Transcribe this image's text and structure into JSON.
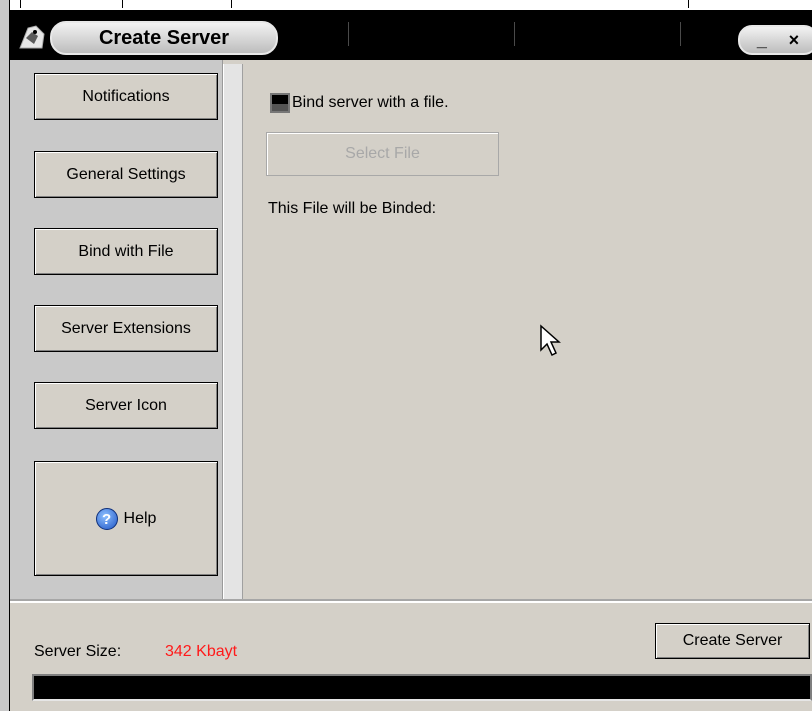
{
  "window": {
    "title": "Create Server",
    "controls": {
      "minimize": "_",
      "close": "×"
    }
  },
  "sidebar": {
    "items": [
      {
        "label": "Notifications"
      },
      {
        "label": "General Settings"
      },
      {
        "label": "Bind with File"
      },
      {
        "label": "Server Extensions"
      },
      {
        "label": "Server Icon"
      },
      {
        "label": "Help",
        "icon": "help-icon"
      }
    ]
  },
  "main": {
    "bind_checkbox_label": "Bind server with a file.",
    "bind_checkbox_checked": false,
    "select_file_button": "Select File",
    "select_file_enabled": false,
    "binded_label": "This File will be Binded:"
  },
  "footer": {
    "size_label": "Server Size:",
    "size_value": "342 Kbayt",
    "size_value_color": "#ff1a1a",
    "create_button": "Create Server",
    "progress": 0
  }
}
